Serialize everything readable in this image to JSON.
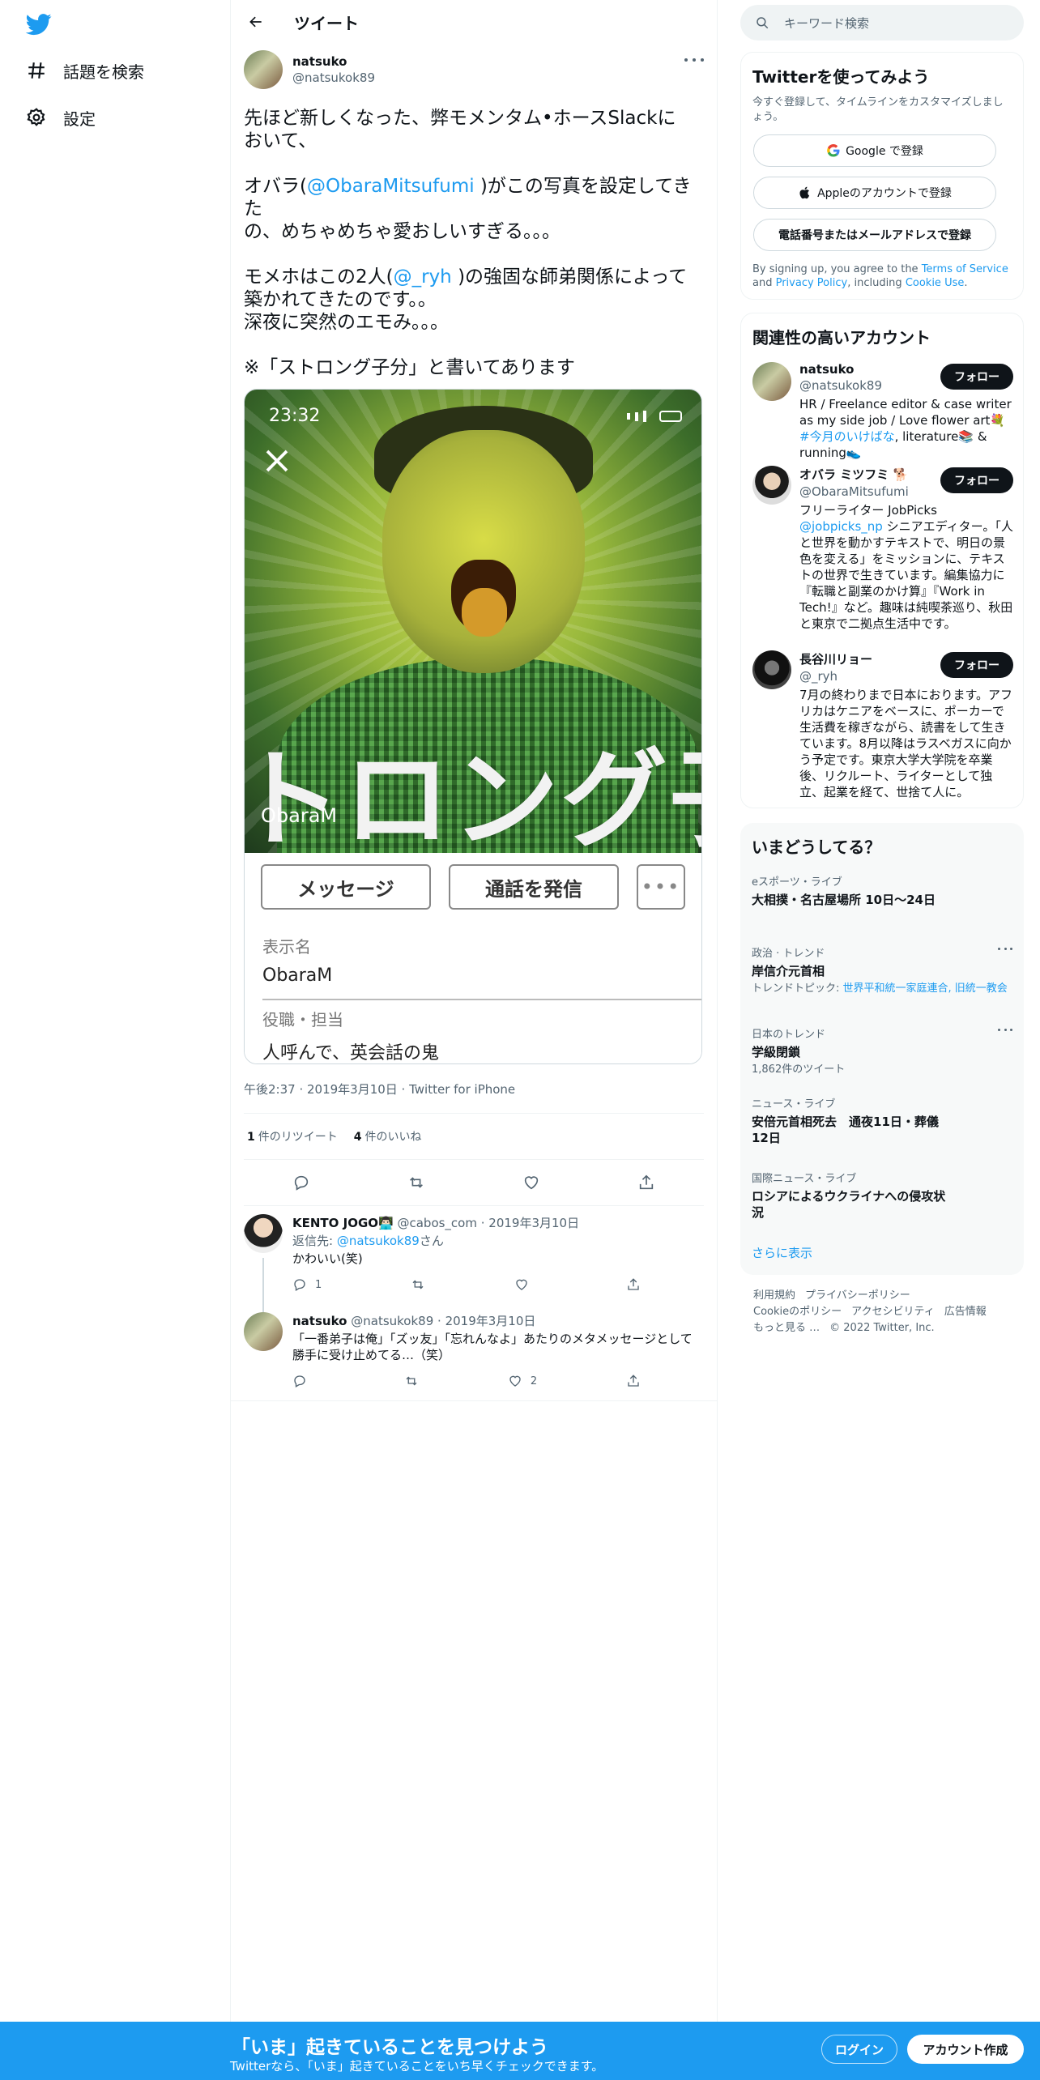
{
  "nav": {
    "logo": "twitter-bird",
    "items": [
      {
        "label": "話題を検索",
        "icon": "hashtag-icon"
      },
      {
        "label": "設定",
        "icon": "gear-icon"
      }
    ]
  },
  "header": {
    "title": "ツイート"
  },
  "tweet": {
    "display_name": "natsuko",
    "handle": "@natsukok89",
    "lines": [
      "先ほど新しくなった、弊モメンタム•ホースSlackに",
      "おいて、",
      "",
      "オバラ(",
      "@ObaraMitsufumi",
      " )がこの写真を設定してきた",
      "の、めちゃめちゃ愛おしいすぎる。。。",
      "",
      "モメホはこの2人(",
      "@_ryh",
      " )の強固な師弟関係によって",
      "築かれてきたのです。。",
      "深夜に突然のエモみ。。。",
      "",
      "※「ストロング子分」と書いてあります"
    ],
    "media": {
      "status_time": "23:32",
      "big_text": "トロング子",
      "contact_name": "ObaraM",
      "buttons": [
        "メッセージ",
        "通話を発信",
        "•••"
      ],
      "fields": [
        {
          "label": "表示名",
          "value": "ObaraM"
        },
        {
          "label": "役職・担当",
          "value": "人呼んで、英会話の鬼"
        }
      ]
    },
    "meta": "午後2:37 · 2019年3月10日 · Twitter for iPhone",
    "retweets_count": "1",
    "retweets_label": "件のリツイート",
    "likes_count": "4",
    "likes_label": "件のいいね"
  },
  "replies": [
    {
      "name": "KENTO JOGO👨🏻‍💻",
      "handle": "@cabos_com",
      "date": "2019年3月10日",
      "reply_to_prefix": "返信先: ",
      "reply_to": "@natsukok89",
      "reply_to_suffix": "さん",
      "text": "かわいい(笑)",
      "reply_count": "1",
      "like_count": ""
    },
    {
      "name": "natsuko",
      "handle": "@natsukok89",
      "date": "2019年3月10日",
      "text": "「一番弟子は俺」「ズッ友」「忘れんなよ」あたりのメタメッセージとして勝手に受け止めてる…（笑）",
      "reply_count": "",
      "like_count": "2"
    }
  ],
  "search": {
    "placeholder": "キーワード検索"
  },
  "signup": {
    "title": "Twitterを使ってみよう",
    "subtitle": "今すぐ登録して、タイムラインをカスタマイズしましょう。",
    "google": "Google で登録",
    "apple": "Appleのアカウントで登録",
    "phone": "電話番号またはメールアドレスで登録",
    "terms_prefix": "By signing up, you agree to the ",
    "terms_link": "Terms of Service",
    "terms_and": " and ",
    "privacy_link": "Privacy Policy",
    "terms_including": ", including ",
    "cookie_link": "Cookie Use",
    "terms_end": "."
  },
  "recommended": {
    "title": "関連性の高いアカウント",
    "follow_label": "フォロー",
    "accounts": [
      {
        "name": "natsuko",
        "handle": "@natsukok89",
        "bio_pre": "HR / Freelance editor & case writer as my side job / Love flower art💐 ",
        "bio_link": "#今月のいけばな",
        "bio_post": ", literature📚 & running👟"
      },
      {
        "name": "オバラ ミツフミ 🐕",
        "handle": "@ObaraMitsufumi",
        "bio_pre": "フリーライター JobPicks ",
        "bio_link": "@jobpicks_np",
        "bio_post": " シニアエディター。「人と世界を動かすテキストで、明日の景色を変える」をミッションに、テキストの世界で生きています。編集協力に『転職と副業のかけ算』『Work in Tech!』など。趣味は純喫茶巡り、秋田と東京で二拠点生活中です。"
      },
      {
        "name": "長谷川リョー",
        "handle": "@_ryh",
        "bio_pre": "7月の終わりまで日本におります。アフリカはケニアをベースに、ポーカーで生活費を稼ぎながら、読書をして生きています。8月以降はラスベガスに向かう予定です。東京大学大学院を卒業後、リクルート、ライターとして独立、起業を経て、世捨て人に。",
        "bio_link": "",
        "bio_post": ""
      }
    ]
  },
  "trends": {
    "title": "いまどうしてる？",
    "items": [
      {
        "category": "eスポーツ・ライブ",
        "name": "大相撲・名古屋場所 10日〜24日",
        "sub_pre": "",
        "sub_link": "",
        "more": false
      },
      {
        "category": "政治 · トレンド",
        "name": "岸信介元首相",
        "sub_pre": "トレンドトピック: ",
        "sub_link": "世界平和統一家庭連合, 旧統一教会",
        "more": true
      },
      {
        "category": "日本のトレンド",
        "name": "学級閉鎖",
        "sub_pre": "1,862件のツイート",
        "sub_link": "",
        "more": true
      },
      {
        "category": "ニュース・ライブ",
        "name": "安倍元首相死去　通夜11日・葬儀12日",
        "sub_pre": "",
        "sub_link": "",
        "more": false
      },
      {
        "category": "国際ニュース・ライブ",
        "name": "ロシアによるウクライナへの侵攻状況",
        "sub_pre": "",
        "sub_link": "",
        "more": false
      }
    ],
    "show_more": "さらに表示"
  },
  "footer": {
    "links": [
      "利用規約",
      "プライバシーポリシー",
      "Cookieのポリシー",
      "アクセシビリティ",
      "広告情報",
      "もっと見る …"
    ],
    "copyright": "© 2022 Twitter, Inc."
  },
  "bottom_bar": {
    "title": "「いま」起きていることを見つけよう",
    "subtitle": "Twitterなら、「いま」起きていることをいち早くチェックできます。",
    "login": "ログイン",
    "signup": "アカウント作成"
  },
  "colors": {
    "accent": "#1d9bf0",
    "text": "#0f1419",
    "muted": "#536471",
    "border": "#eff3f4"
  }
}
